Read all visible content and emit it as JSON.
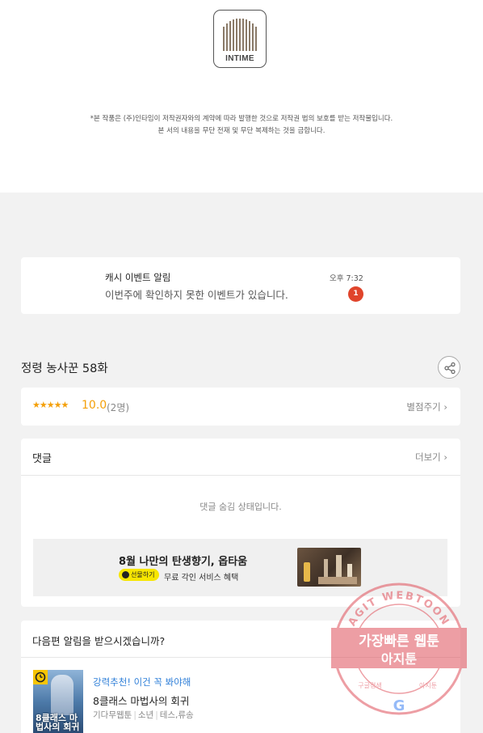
{
  "publisher": {
    "logo_text": "INTIME",
    "notice_line1": "*본 작품은 (주)인타임이 저작권자와의 계약에 따라 발행한 것으로 저작권 법의 보호를 받는 저작물입니다.",
    "notice_line2": "본 서의 내용을 무단 전재 및 무단 복제하는 것을 금합니다."
  },
  "notification": {
    "title": "캐시 이벤트 알림",
    "message": "이번주에 확인하지 못한 이벤트가 있습니다.",
    "time": "오후 7:32",
    "badge": "1"
  },
  "episode": {
    "title": "정령 농사꾼 58화",
    "share_icon": "share-icon"
  },
  "rating": {
    "stars": "★★★★★",
    "stars_value": 5,
    "score": "10.0",
    "count": "(2명)",
    "rate_link": "별점주기 ›"
  },
  "comments": {
    "title": "댓글",
    "more": "더보기 ›",
    "hidden_text": "댓글 숨김 상태입니다."
  },
  "ad": {
    "title": "8월 나만의 탄생향기, 옵타움",
    "badge": "선물하기",
    "subtitle": "무료 각인 서비스 혜택"
  },
  "subscribe": {
    "question": "다음편 알림을 받으시겠습니까?",
    "recommend_tag": "강력추천! 이건 꼭 봐야해",
    "recommend_title": "8클래스 마법사의 회귀",
    "thumb_title": "8클래스 마법사의 회귀",
    "meta": [
      "기다무웹툰",
      "소년",
      "테스,류송"
    ]
  },
  "watermark": {
    "arc_text": "AGIT WEBTOON",
    "line1": "가장빠른 웹툰",
    "line2": "아지툰",
    "bottom_left": "구글검색",
    "bottom_right": "아지툰"
  },
  "colors": {
    "accent_orange": "#f4a00a",
    "badge_red": "#e0442b",
    "link_blue": "#2f7fd8",
    "ad_yellow": "#f7e600",
    "watermark_red": "#e0505a"
  }
}
